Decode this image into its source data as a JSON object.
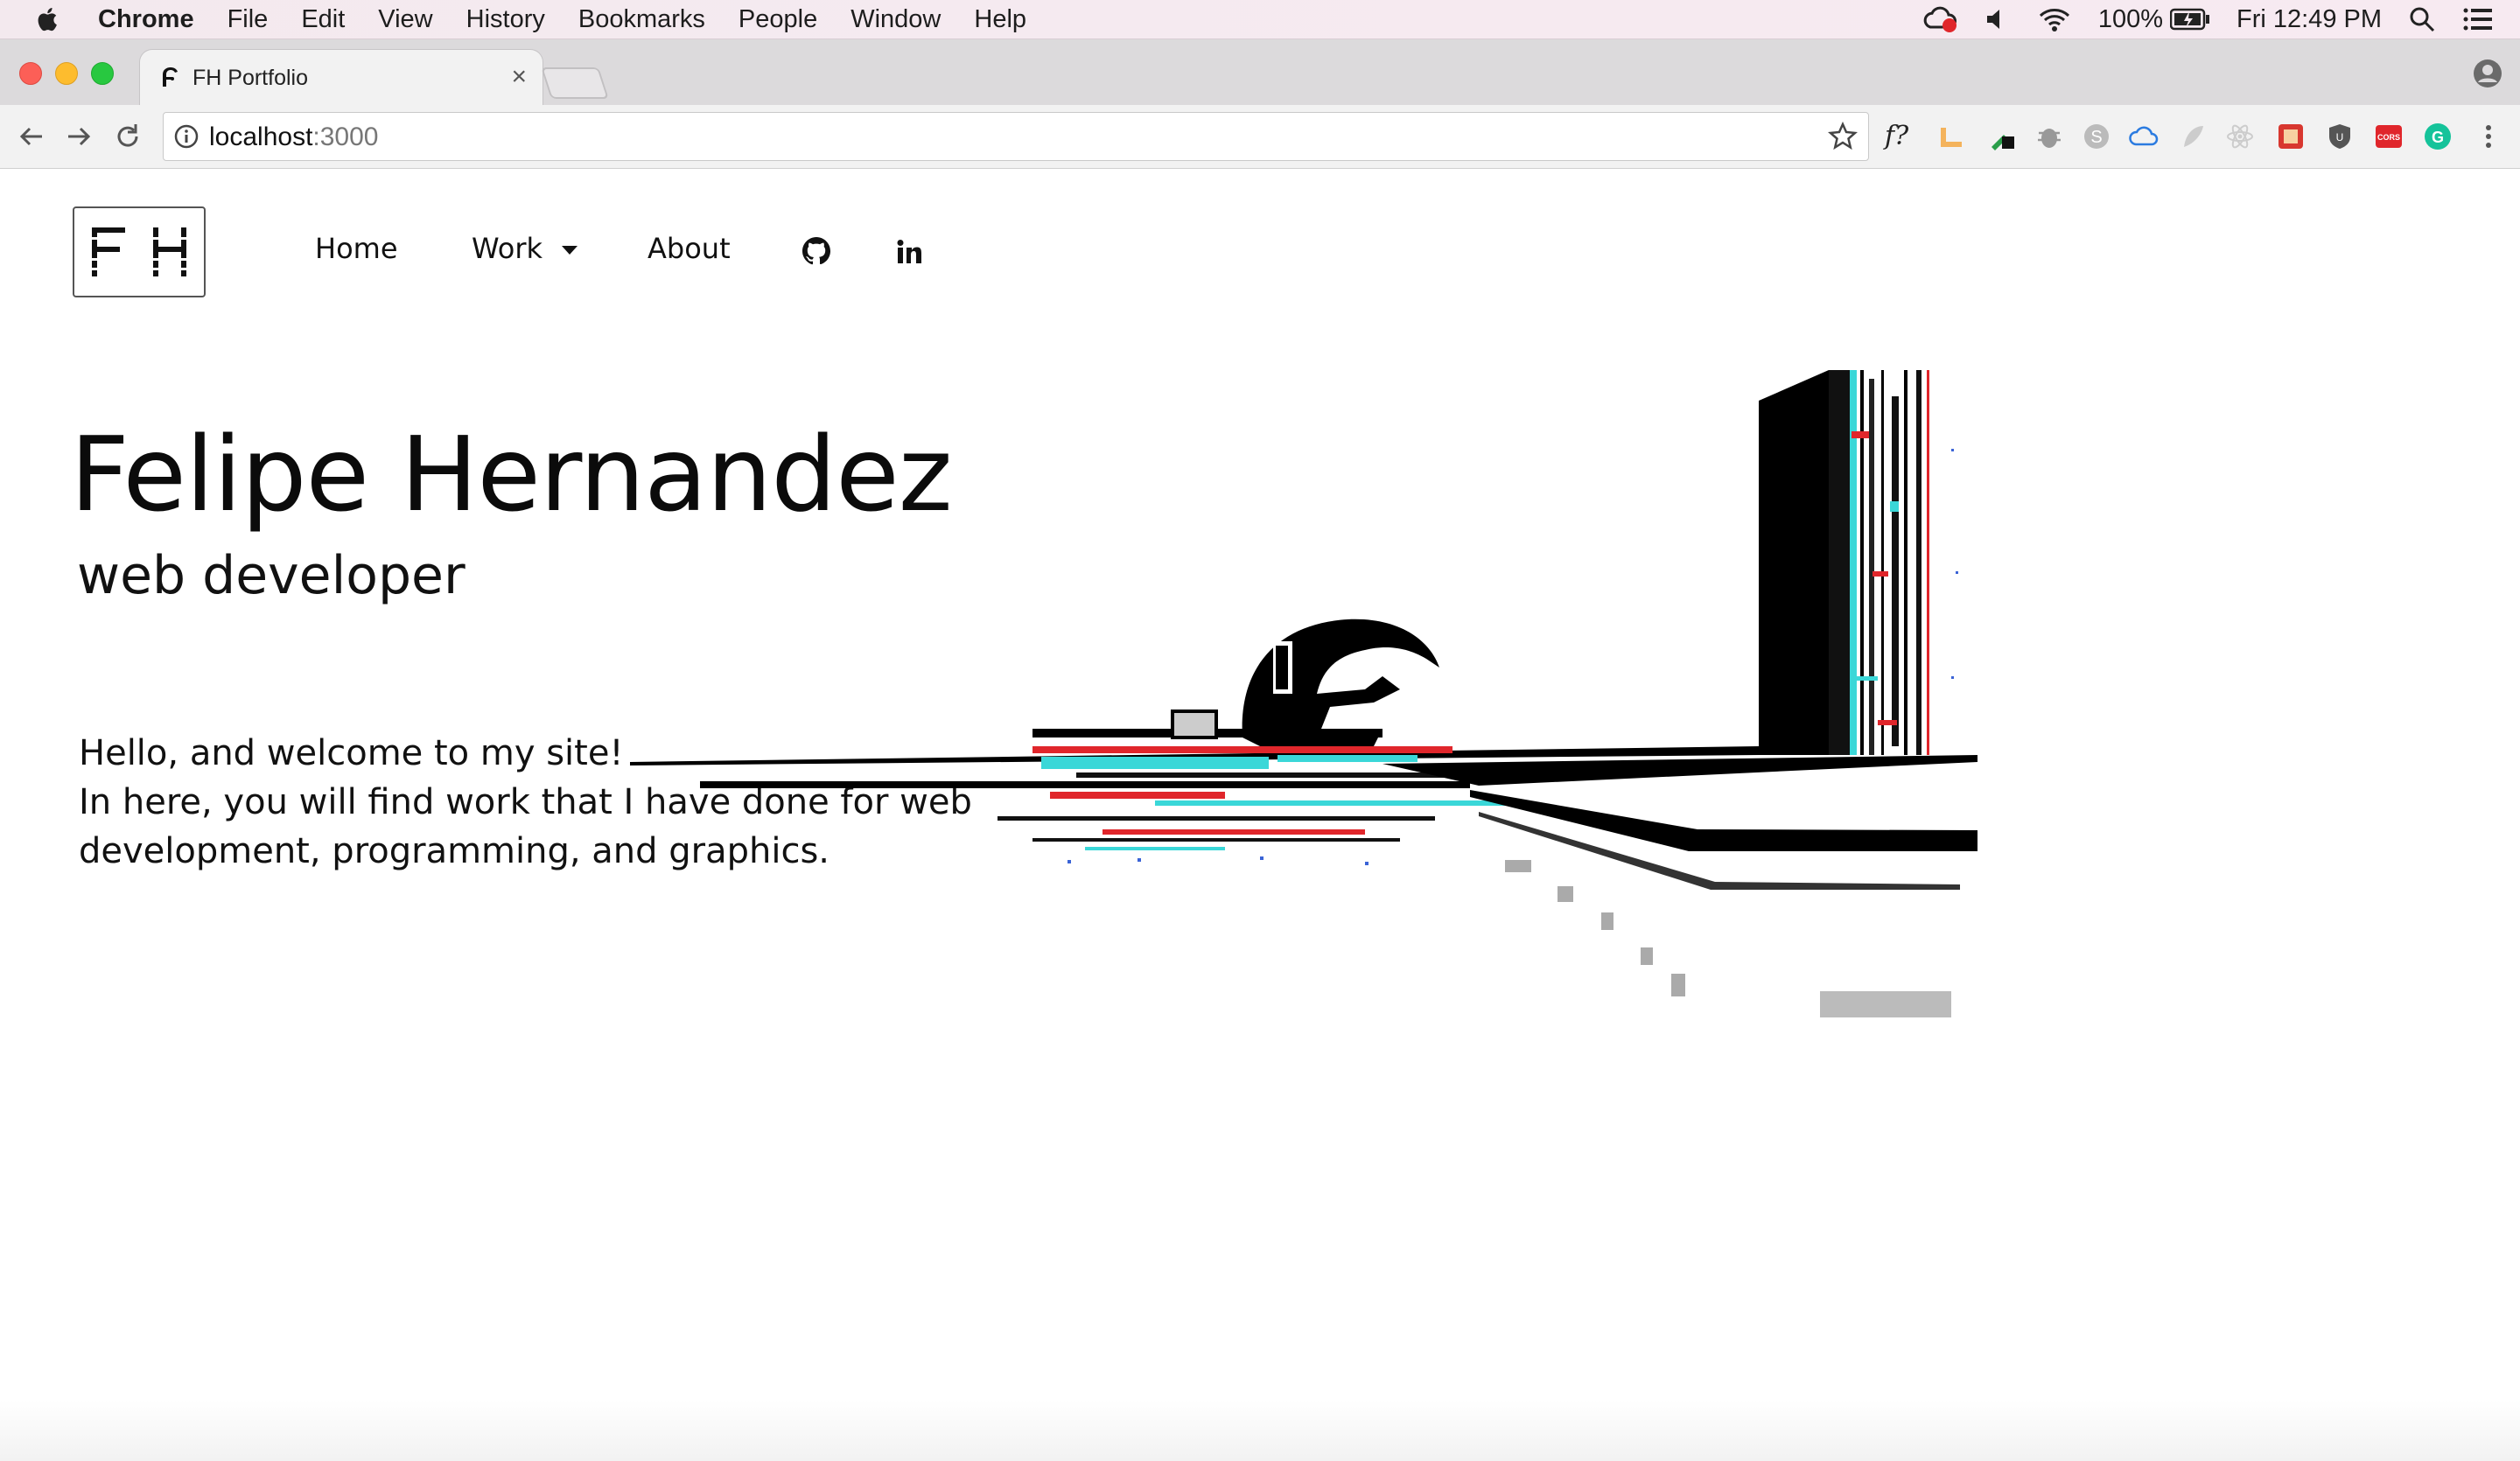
{
  "menubar": {
    "app": "Chrome",
    "items": [
      "File",
      "Edit",
      "View",
      "History",
      "Bookmarks",
      "People",
      "Window",
      "Help"
    ],
    "battery": "100%",
    "clock": "Fri 12:49 PM"
  },
  "browser": {
    "tab_title": "FH Portfolio",
    "tab_close": "×",
    "url_host": "localhost",
    "url_port": ":3000",
    "ext_fquestion": "f?"
  },
  "site": {
    "logo_text": "FH",
    "nav": {
      "home": "Home",
      "work": "Work",
      "about": "About"
    },
    "hero": {
      "name": "Felipe Hernandez",
      "role": "web developer"
    },
    "intro": [
      "Hello, and welcome to my site!",
      "In here, you will find work that I have done for web",
      "development, programming, and graphics."
    ]
  },
  "colors": {
    "accent_red": "#e0262b",
    "glitch_cyan": "#3ad7d8",
    "text": "#111111"
  }
}
